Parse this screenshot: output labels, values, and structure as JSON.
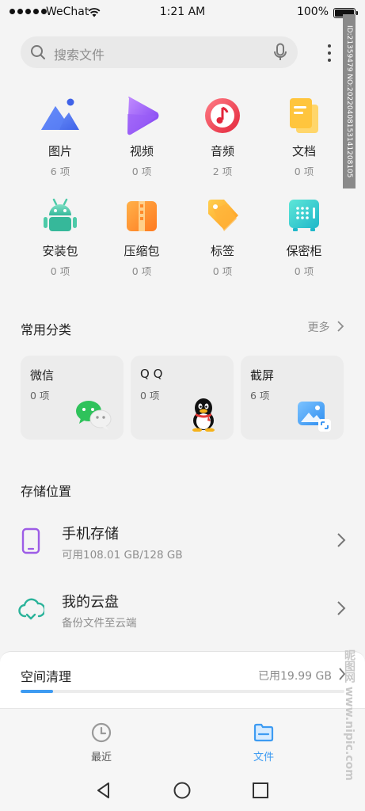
{
  "status_bar": {
    "carrier": "WeChat",
    "time": "1:21 AM",
    "battery": "100%"
  },
  "search": {
    "placeholder": "搜索文件",
    "icon": "search-icon",
    "mic_icon": "microphone-icon"
  },
  "categories": [
    {
      "name": "图片",
      "count": "6 项",
      "icon": "image-icon"
    },
    {
      "name": "视频",
      "count": "0 项",
      "icon": "video-icon"
    },
    {
      "name": "音频",
      "count": "2 项",
      "icon": "music-icon"
    },
    {
      "name": "文档",
      "count": "0 项",
      "icon": "document-icon"
    },
    {
      "name": "安装包",
      "count": "0 项",
      "icon": "android-icon"
    },
    {
      "name": "压缩包",
      "count": "0 项",
      "icon": "zip-icon"
    },
    {
      "name": "标签",
      "count": "0 项",
      "icon": "tag-icon"
    },
    {
      "name": "保密柜",
      "count": "0 项",
      "icon": "safe-icon"
    }
  ],
  "common": {
    "title": "常用分类",
    "more": "更多",
    "cards": [
      {
        "title": "微信",
        "count": "0 项",
        "icon": "wechat-icon"
      },
      {
        "title": "Q Q",
        "count": "0 项",
        "icon": "qq-penguin-icon"
      },
      {
        "title": "截屏",
        "count": "6 项",
        "icon": "screenshot-icon"
      }
    ]
  },
  "storage": {
    "title": "存储位置",
    "items": [
      {
        "title": "手机存储",
        "subtitle": "可用108.01 GB/128 GB",
        "icon": "phone-icon"
      },
      {
        "title": "我的云盘",
        "subtitle": "备份文件至云端",
        "icon": "cloud-icon"
      }
    ]
  },
  "cleanup": {
    "title": "空间清理",
    "used": "已用19.99 GB",
    "progress": 0.1
  },
  "tabs": [
    {
      "label": "最近",
      "icon": "clock-icon",
      "active": false
    },
    {
      "label": "文件",
      "icon": "folder-icon",
      "active": true
    }
  ],
  "watermark": {
    "id_text": "ID:21359479 NO:20220408153141208105",
    "site_text": "昵图网 www.nipic.com"
  },
  "colors": {
    "accent": "#3d9bf2",
    "muted": "#8d8d8d"
  }
}
